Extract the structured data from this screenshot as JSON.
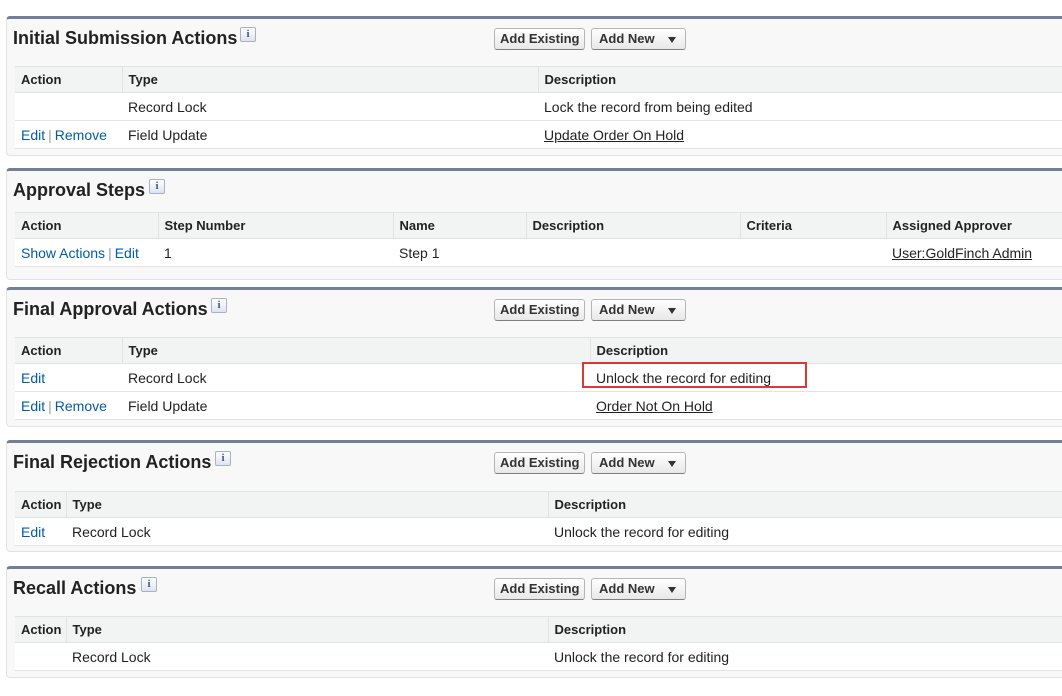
{
  "common": {
    "add_existing": "Add Existing",
    "add_new": "Add New",
    "info": "i",
    "separator": "|",
    "edit": "Edit",
    "remove": "Remove",
    "show_actions": "Show Actions"
  },
  "initial_submission": {
    "title": "Initial Submission Actions",
    "columns": [
      "Action",
      "Type",
      "Description"
    ],
    "rows": [
      {
        "type": "Record Lock",
        "description": "Lock the record from being edited"
      },
      {
        "type": "Field Update",
        "description": "Update Order On Hold"
      }
    ]
  },
  "approval_steps": {
    "title": "Approval Steps",
    "columns": [
      "Action",
      "Step Number",
      "Name",
      "Description",
      "Criteria",
      "Assigned Approver"
    ],
    "rows": [
      {
        "step_number": "1",
        "name": "Step 1",
        "description": "",
        "criteria": "",
        "approver": "User:GoldFinch Admin"
      }
    ]
  },
  "final_approval": {
    "title": "Final Approval Actions",
    "columns": [
      "Action",
      "Type",
      "Description"
    ],
    "rows": [
      {
        "type": "Record Lock",
        "description": "Unlock the record for editing"
      },
      {
        "type": "Field Update",
        "description": "Order Not On Hold"
      }
    ]
  },
  "final_rejection": {
    "title": "Final Rejection Actions",
    "columns": [
      "Action",
      "Type",
      "Description"
    ],
    "rows": [
      {
        "type": "Record Lock",
        "description": "Unlock the record for editing"
      }
    ]
  },
  "recall": {
    "title": "Recall Actions",
    "columns": [
      "Action",
      "Type",
      "Description"
    ],
    "rows": [
      {
        "type": "Record Lock",
        "description": "Unlock the record for editing"
      }
    ]
  },
  "colors": {
    "section_border": "#747e96",
    "link": "#015ba7",
    "highlight": "#d93a36"
  }
}
